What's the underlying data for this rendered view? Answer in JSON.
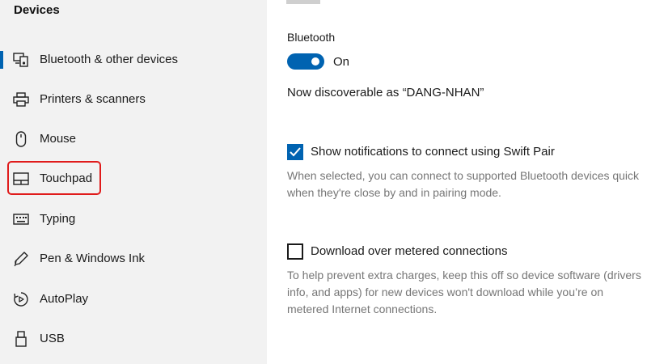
{
  "sidebar": {
    "title": "Devices",
    "items": [
      {
        "label": "Bluetooth & other devices",
        "icon": "bluetooth-devices-icon"
      },
      {
        "label": "Printers & scanners",
        "icon": "printer-icon"
      },
      {
        "label": "Mouse",
        "icon": "mouse-icon"
      },
      {
        "label": "Touchpad",
        "icon": "touchpad-icon"
      },
      {
        "label": "Typing",
        "icon": "keyboard-icon"
      },
      {
        "label": "Pen & Windows Ink",
        "icon": "pen-icon"
      },
      {
        "label": "AutoPlay",
        "icon": "autoplay-icon"
      },
      {
        "label": "USB",
        "icon": "usb-icon"
      }
    ],
    "selected": "Bluetooth & other devices",
    "highlighted": "Touchpad"
  },
  "main": {
    "bluetooth_label": "Bluetooth",
    "bluetooth_toggle": {
      "state": "On",
      "on": true
    },
    "discoverable_text": "Now discoverable as “DANG-NHAN”",
    "swift_pair": {
      "label": "Show notifications to connect using Swift Pair",
      "checked": true,
      "description_lines": [
        "When selected, you can connect to supported Bluetooth devices quick",
        "when they're close by and in pairing mode."
      ]
    },
    "metered": {
      "label": "Download over metered connections",
      "checked": false,
      "description_lines": [
        "To help prevent extra charges, keep this off so device software (drivers",
        "info, and apps) for new devices won't download while you’re on",
        "metered Internet connections."
      ]
    }
  },
  "colors": {
    "accent": "#0063b1",
    "highlight_box": "#e01b1b",
    "sidebar_bg": "#f2f2f2",
    "description_text": "#767676"
  }
}
